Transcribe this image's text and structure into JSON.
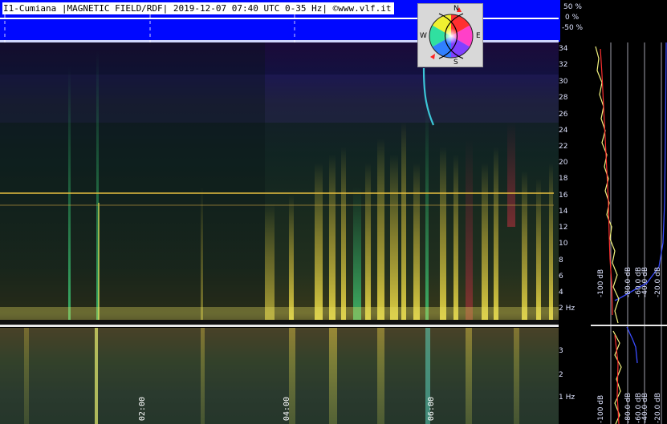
{
  "header": {
    "title": "I1-Cumiana |MAGNETIC FIELD/RDF| 2019-12-07 07:40 UTC 0-35 Hz| ©www.vlf.it"
  },
  "top_scale": {
    "labels": [
      "50 %",
      "0 %",
      "-50 %"
    ]
  },
  "compass": {
    "north": "N",
    "south": "S",
    "east": "E",
    "west": "W"
  },
  "frequency_axis_main": {
    "labels": [
      "34",
      "32",
      "30",
      "28",
      "26",
      "24",
      "22",
      "20",
      "18",
      "16",
      "14",
      "12",
      "10",
      "8",
      "6",
      "4",
      "2 Hz"
    ]
  },
  "frequency_axis_lower": {
    "labels": [
      "3",
      "2",
      "1 Hz"
    ]
  },
  "db_axis_main": {
    "labels": [
      "-100 dB",
      "-80.0 dB",
      "-60.0 dB",
      "-40.0 dB",
      "-20.0 dB"
    ]
  },
  "db_axis_lower": {
    "labels": [
      "-100 dB",
      "-80.0 dB",
      "-60.0 dB",
      "-40.0 dB",
      "-20.0 dB"
    ]
  },
  "time_axis": {
    "labels": [
      "02:00",
      "04:00",
      "06:00"
    ]
  },
  "colors": {
    "header_blue": "#0008ff",
    "trace_yellow": "#f5f580",
    "trace_red": "#ff3030",
    "trace_blue": "#3a4cff"
  }
}
